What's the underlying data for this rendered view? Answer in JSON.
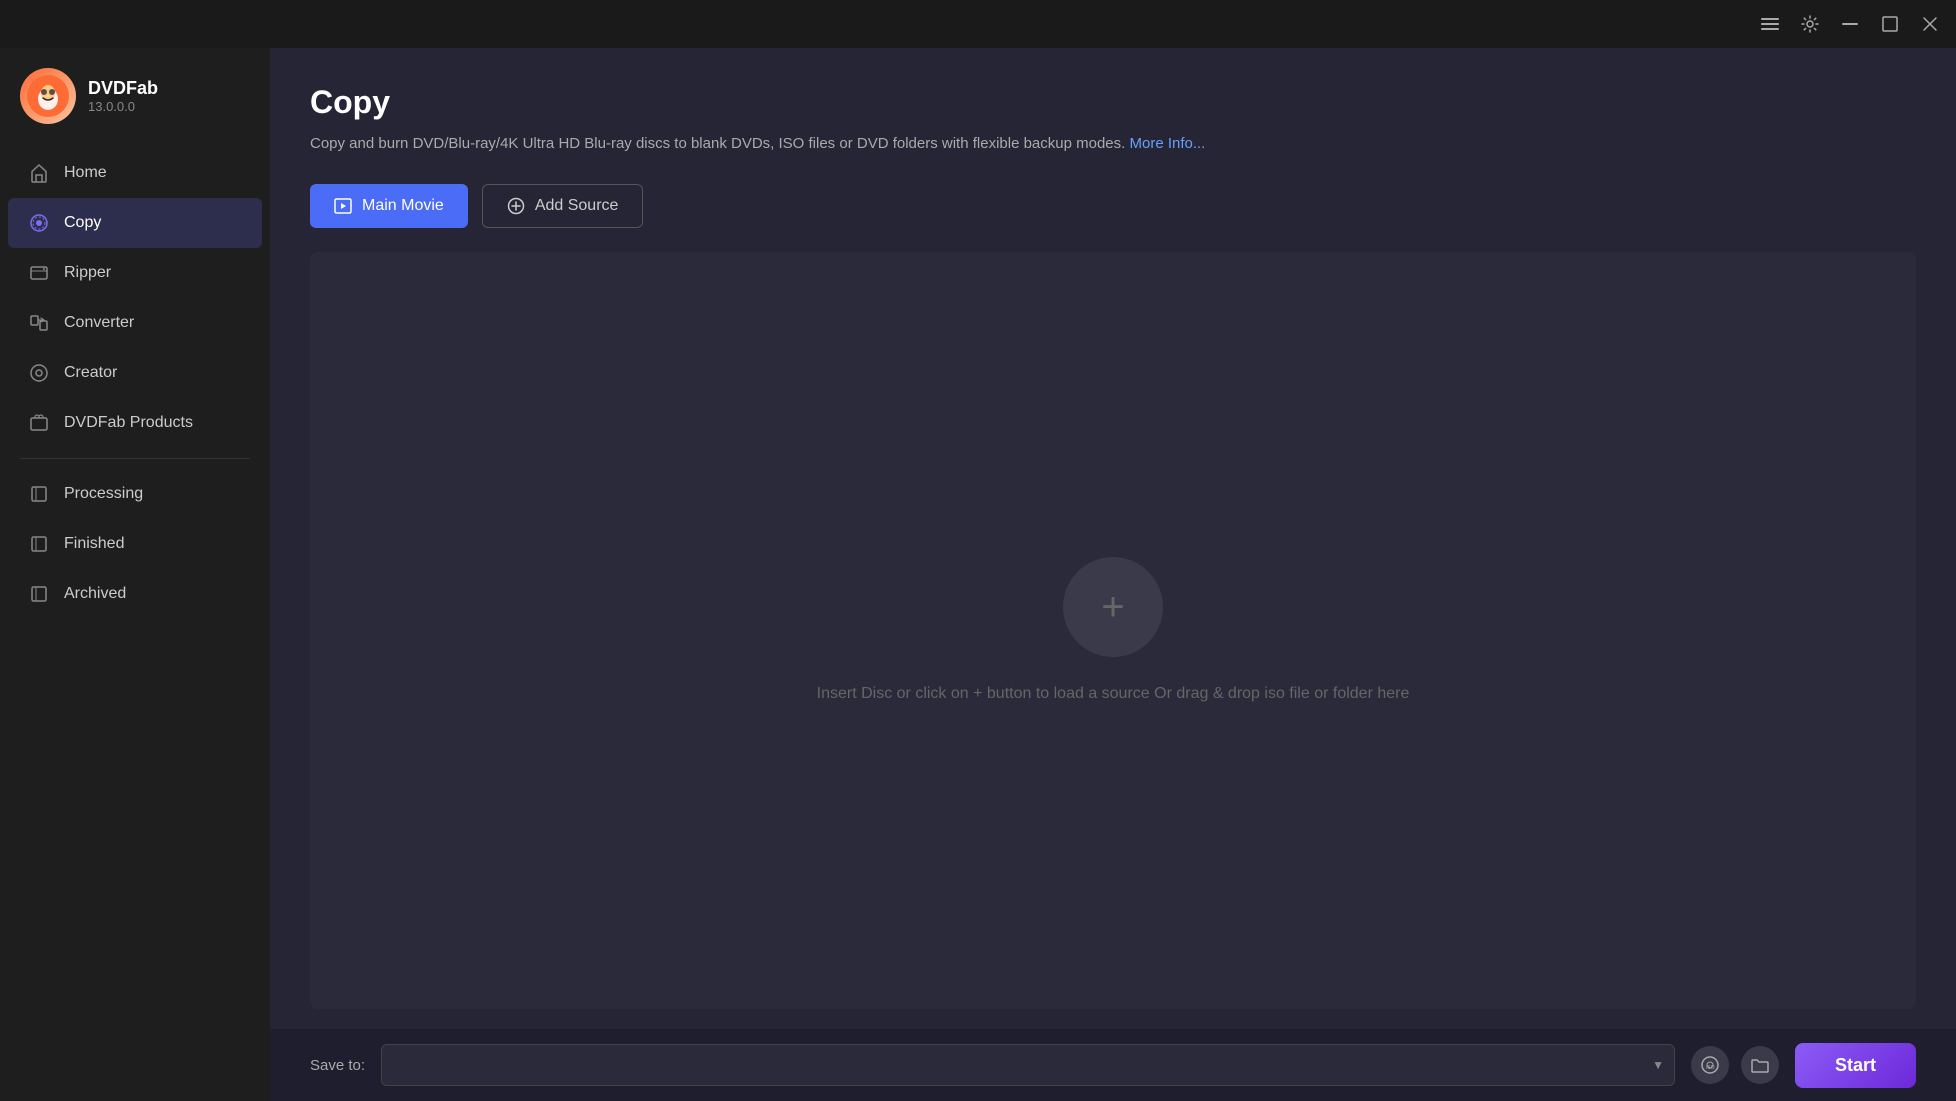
{
  "titlebar": {
    "controls": [
      "menu-icon",
      "minimize-icon",
      "maximize-icon",
      "close-icon"
    ]
  },
  "sidebar": {
    "logo": {
      "name": "DVDFab",
      "version": "13.0.0.0"
    },
    "nav_items": [
      {
        "id": "home",
        "label": "Home",
        "icon": "home-icon",
        "active": false
      },
      {
        "id": "copy",
        "label": "Copy",
        "icon": "copy-icon",
        "active": true
      },
      {
        "id": "ripper",
        "label": "Ripper",
        "icon": "ripper-icon",
        "active": false
      },
      {
        "id": "converter",
        "label": "Converter",
        "icon": "converter-icon",
        "active": false
      },
      {
        "id": "creator",
        "label": "Creator",
        "icon": "creator-icon",
        "active": false
      },
      {
        "id": "dvdfab-products",
        "label": "DVDFab Products",
        "icon": "products-icon",
        "active": false
      }
    ],
    "queue_items": [
      {
        "id": "processing",
        "label": "Processing",
        "icon": "processing-icon"
      },
      {
        "id": "finished",
        "label": "Finished",
        "icon": "finished-icon"
      },
      {
        "id": "archived",
        "label": "Archived",
        "icon": "archived-icon"
      }
    ]
  },
  "main": {
    "page_title": "Copy",
    "page_description": "Copy and burn DVD/Blu-ray/4K Ultra HD Blu-ray discs to blank DVDs, ISO files or DVD folders with flexible backup modes.",
    "more_info_label": "More Info...",
    "toolbar": {
      "main_movie_label": "Main Movie",
      "add_source_label": "Add Source"
    },
    "drop_zone": {
      "instruction": "Insert Disc or click on + button to load a source Or drag & drop iso file or folder here"
    }
  },
  "bottom_bar": {
    "save_to_label": "Save to:",
    "save_to_value": "",
    "start_label": "Start"
  }
}
